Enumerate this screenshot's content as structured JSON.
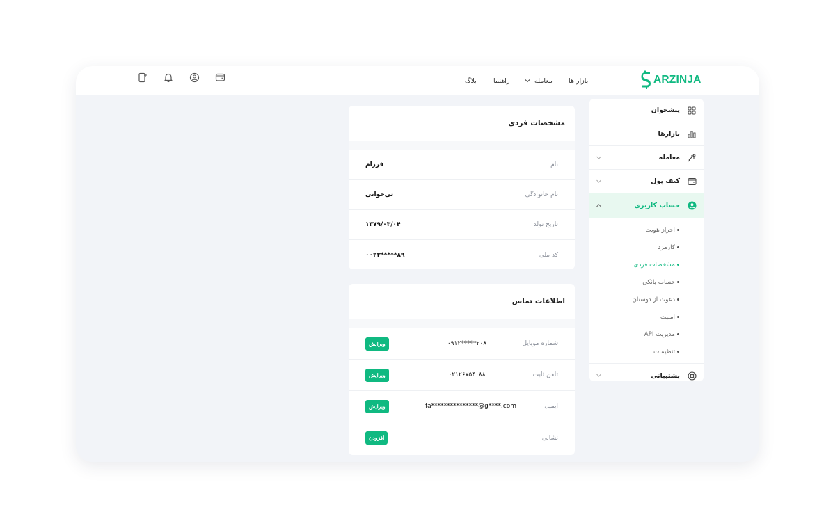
{
  "brand": {
    "name": "ARZINJA",
    "color": "#10b981"
  },
  "nav": {
    "markets": "بازار ها",
    "trade": "معامله",
    "guide": "راهنما",
    "blog": "بلاگ"
  },
  "top_icons": [
    "add-device-icon",
    "bell-icon",
    "user-circle-icon",
    "wallet-icon"
  ],
  "sidebar": {
    "dashboard": "پیشخوان",
    "markets": "بازارها",
    "trade": "معامله",
    "wallet": "کیف پول",
    "account": "حساب کاربری",
    "account_sub": [
      "احراز هویت",
      "کارمزد",
      "مشخصات فردی",
      "حساب بانکی",
      "دعوت از دوستان",
      "امنیت",
      "مدیریت API",
      "تنظیمات"
    ],
    "support": "پشتیبانی"
  },
  "personal": {
    "title": "مشخصات فردی",
    "rows": [
      {
        "label": "نام",
        "value": "فرزام"
      },
      {
        "label": "نام خانوادگی",
        "value": "تی‌خوانی"
      },
      {
        "label": "تاریخ تولد",
        "value": "۱۳۷۹/۰۳/۰۴"
      },
      {
        "label": "کد ملی",
        "value": "۰۰۲۳*****۸۹"
      }
    ]
  },
  "contact": {
    "title": "اطلاعات تماس",
    "rows": [
      {
        "label": "شماره موبایل",
        "value": "۰۹۱۲*****۲۰۸",
        "action": "ویرایش"
      },
      {
        "label": "تلفن ثابت",
        "value": "۰۲۱۲۶۷۵۴۰۸۸",
        "action": "ویرایش"
      },
      {
        "label": "ایمیل",
        "value": "fa***************@g****.com",
        "action": "ویرایش"
      },
      {
        "label": "نشانی",
        "value": "",
        "action": "افزودن"
      }
    ]
  }
}
